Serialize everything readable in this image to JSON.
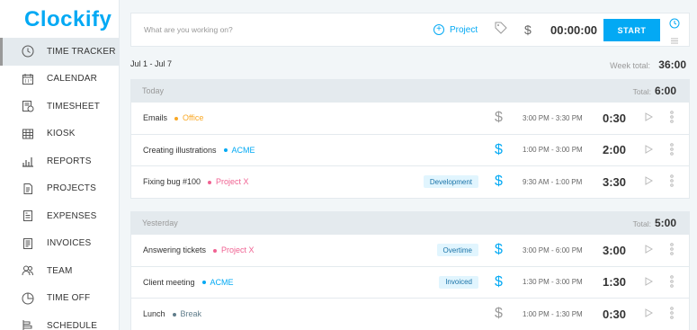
{
  "app": {
    "logo": "Clockify",
    "accent": "#03a9f4"
  },
  "sidebar": {
    "items": [
      {
        "label": "TIME TRACKER",
        "icon": "clock-icon",
        "active": true
      },
      {
        "label": "CALENDAR",
        "icon": "calendar-icon"
      },
      {
        "label": "TIMESHEET",
        "icon": "timesheet-icon"
      },
      {
        "label": "KIOSK",
        "icon": "kiosk-icon"
      },
      {
        "label": "REPORTS",
        "icon": "reports-icon"
      },
      {
        "label": "PROJECTS",
        "icon": "projects-icon"
      },
      {
        "label": "EXPENSES",
        "icon": "expenses-icon"
      },
      {
        "label": "INVOICES",
        "icon": "invoices-icon"
      },
      {
        "label": "TEAM",
        "icon": "team-icon"
      },
      {
        "label": "TIME OFF",
        "icon": "time-off-icon"
      },
      {
        "label": "SCHEDULE",
        "icon": "schedule-icon"
      }
    ]
  },
  "timer": {
    "placeholder": "What are you working on?",
    "project_label": "Project",
    "dollar": "$",
    "value": "00:00:00",
    "start_label": "START"
  },
  "week": {
    "range": "Jul 1 - Jul 7",
    "total_label": "Week total:",
    "total": "36:00"
  },
  "days": [
    {
      "label": "Today",
      "total_label": "Total:",
      "total": "6:00",
      "entries": [
        {
          "description": "Emails",
          "project": "Office",
          "project_color": "#f9a825",
          "badge": "",
          "billable": false,
          "range": "3:00 PM - 3:30 PM",
          "duration": "0:30"
        },
        {
          "description": "Creating illustrations",
          "project": "ACME",
          "project_color": "#03a9f4",
          "badge": "",
          "billable": true,
          "range": "1:00 PM - 3:00 PM",
          "duration": "2:00"
        },
        {
          "description": "Fixing bug #100",
          "project": "Project X",
          "project_color": "#f06292",
          "badge": "Development",
          "billable": true,
          "range": "9:30 AM - 1:00 PM",
          "duration": "3:30"
        }
      ]
    },
    {
      "label": "Yesterday",
      "total_label": "Total:",
      "total": "5:00",
      "entries": [
        {
          "description": "Answering tickets",
          "project": "Project X",
          "project_color": "#f06292",
          "badge": "Overtime",
          "billable": true,
          "range": "3:00 PM - 6:00 PM",
          "duration": "3:00"
        },
        {
          "description": "Client meeting",
          "project": "ACME",
          "project_color": "#03a9f4",
          "badge": "Invoiced",
          "billable": true,
          "range": "1:30 PM - 3:00 PM",
          "duration": "1:30"
        },
        {
          "description": "Lunch",
          "project": "Break",
          "project_color": "#607d8b",
          "badge": "",
          "billable": false,
          "range": "1:00 PM - 1:30 PM",
          "duration": "0:30"
        }
      ]
    }
  ]
}
